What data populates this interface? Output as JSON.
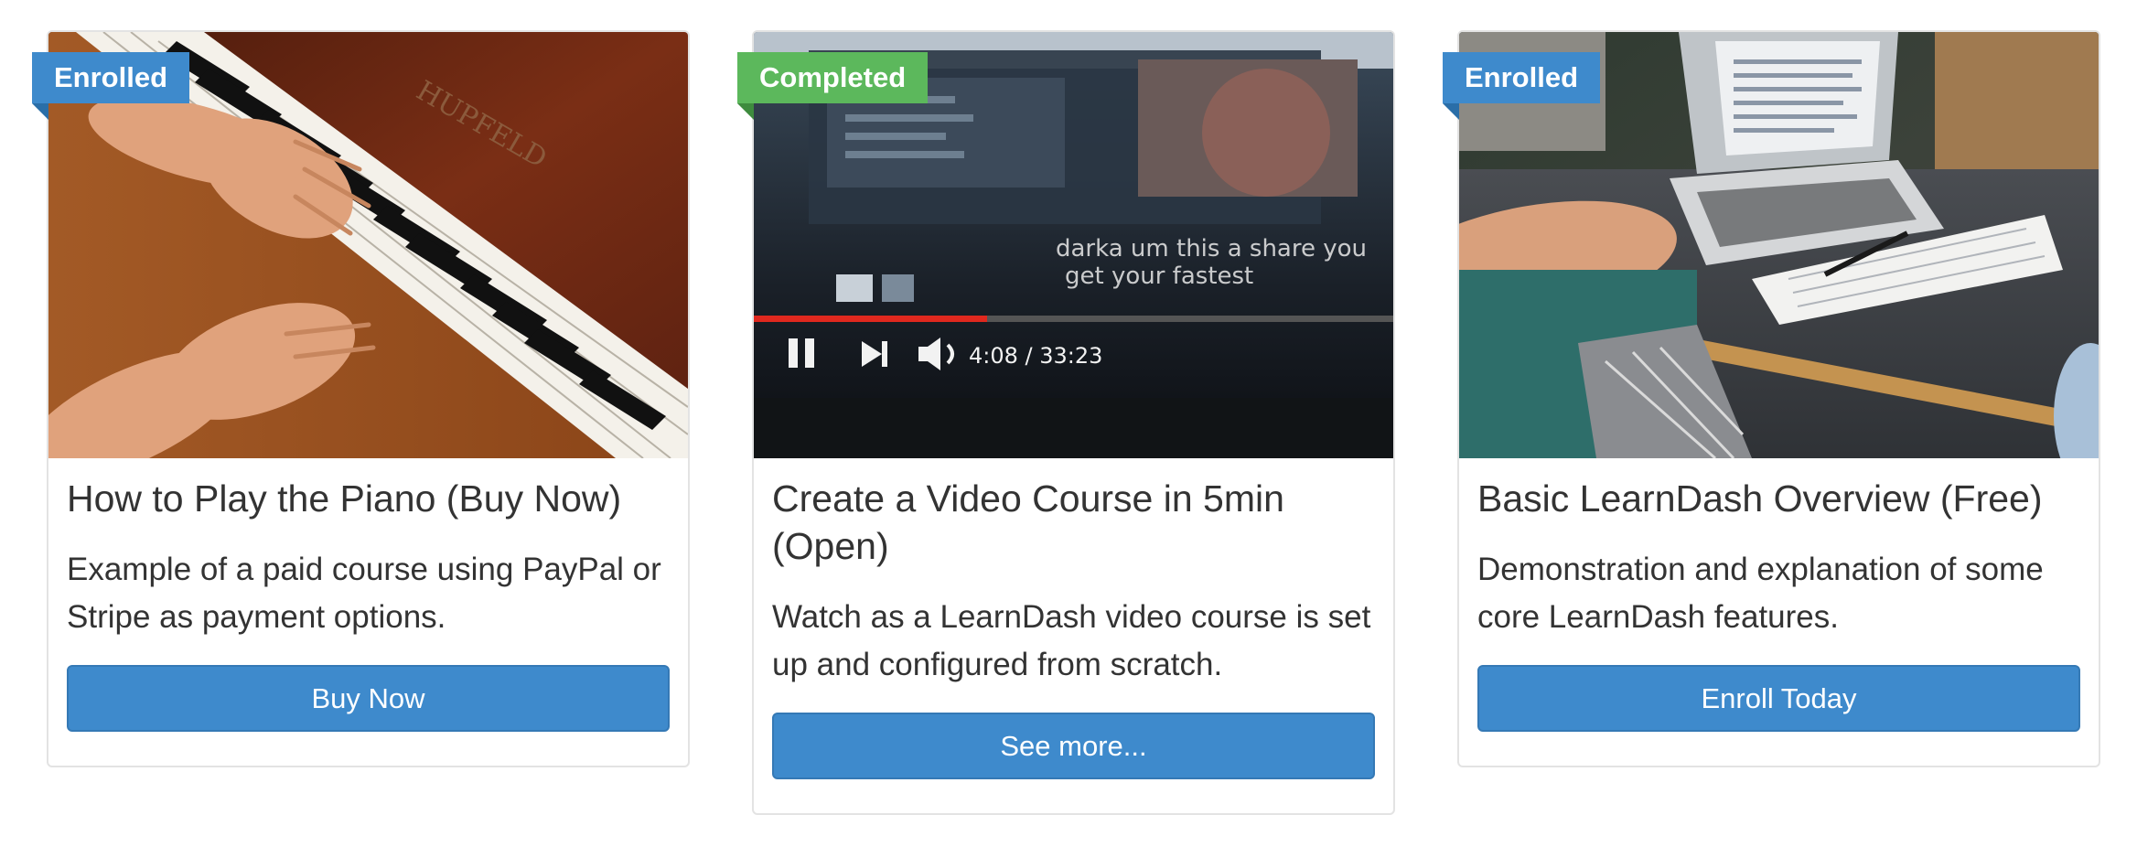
{
  "courses": [
    {
      "badge": "Enrolled",
      "badge_color": "#3e8acc",
      "image_subject": "piano-hands-photo",
      "title": "How to Play the Piano (Buy Now)",
      "description": "Example of a paid course using PayPal or Stripe as payment options.",
      "button_label": "Buy Now",
      "image_text": "HUPFELD"
    },
    {
      "badge": "Completed",
      "badge_color": "#5cb85c",
      "image_subject": "video-player-screen-photo",
      "title": "Create a Video Course in 5min (Open)",
      "description": "Watch as a LearnDash video course is set up and configured from scratch.",
      "button_label": "See more...",
      "image_text": "4:08 / 33:23"
    },
    {
      "badge": "Enrolled",
      "badge_color": "#3e8acc",
      "image_subject": "laptop-desk-photo",
      "title": "Basic LearnDash Overview (Free)",
      "description": "Demonstration and explanation of some core LearnDash features.",
      "button_label": "Enroll Today"
    }
  ],
  "colors": {
    "primary_button": "#3e8acc",
    "enrolled_badge": "#3e8acc",
    "completed_badge": "#5cb85c",
    "text": "#333333"
  }
}
